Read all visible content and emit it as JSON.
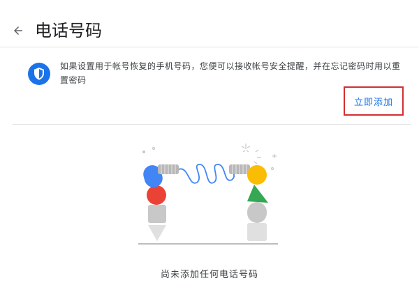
{
  "header": {
    "title": "电话号码",
    "back_icon": "arrow-left-icon"
  },
  "info": {
    "icon": "shield-icon",
    "text": "如果设置用于帐号恢复的手机号码，您便可以接收帐号安全提醒，并在忘记密码时用以重置密码",
    "add_button_label": "立即添加"
  },
  "empty_state": {
    "text": "尚未添加任何电话号码",
    "illustration": "robot-arms-illustration"
  },
  "colors": {
    "accent_blue": "#1a73e8",
    "highlight_red": "#d32f2f",
    "google_blue": "#4285f4",
    "google_red": "#ea4335",
    "google_yellow": "#fbbc04",
    "google_green": "#34a853"
  }
}
